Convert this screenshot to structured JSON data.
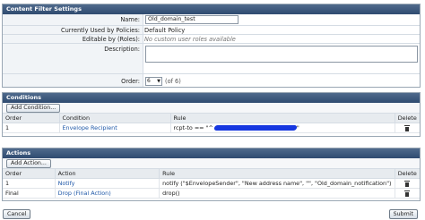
{
  "settings": {
    "title": "Content Filter Settings",
    "name_label": "Name:",
    "name_value": "Old_domain_test",
    "used_by_label": "Currently Used by Policies:",
    "used_by_value": "Default Policy",
    "editable_label": "Editable by (Roles):",
    "editable_value": "No custom user roles available",
    "description_label": "Description:",
    "order_label": "Order:",
    "order_value": "6",
    "order_of": "(of 6)"
  },
  "conditions": {
    "title": "Conditions",
    "add_button": "Add Condition...",
    "headers": {
      "order": "Order",
      "name": "Condition",
      "rule": "Rule",
      "delete": "Delete"
    },
    "rows": [
      {
        "order": "1",
        "name": "Envelope Recipient",
        "rule": "rcpt-to == \"^",
        "rule_end": "\""
      }
    ]
  },
  "actions": {
    "title": "Actions",
    "add_button": "Add Action...",
    "headers": {
      "order": "Order",
      "name": "Action",
      "rule": "Rule",
      "delete": "Delete"
    },
    "rows": [
      {
        "order": "1",
        "name": "Notify",
        "rule": "notify (\"$EnvelopeSender\", \"New address name\", \"\", \"Old_domain_notification\")"
      },
      {
        "order": "Final",
        "name": "Drop (Final Action)",
        "rule": "drop()"
      }
    ]
  },
  "footer": {
    "cancel": "Cancel",
    "submit": "Submit"
  },
  "colors": {
    "header": "#3d5a80",
    "link": "#1f58a8",
    "redaction": "#1637e0"
  }
}
